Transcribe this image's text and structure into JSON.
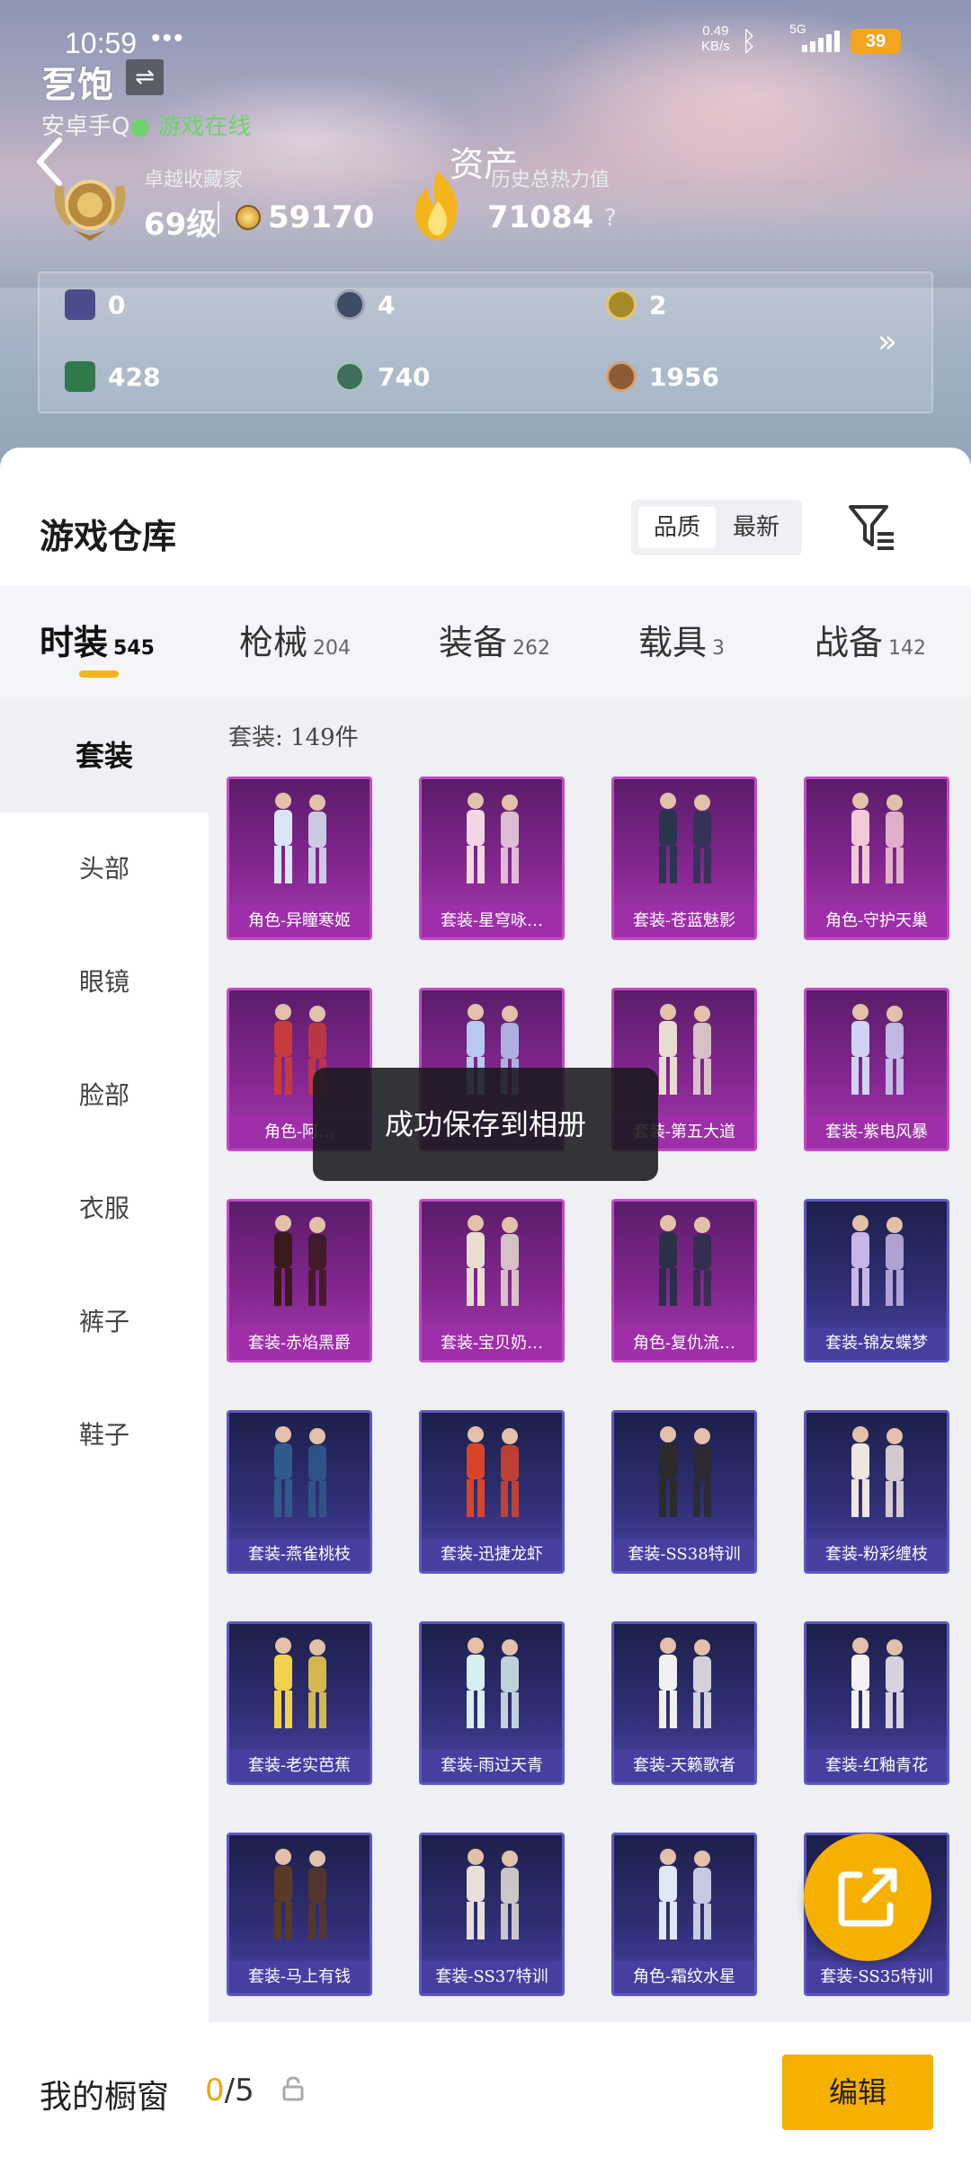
{
  "status_bar": {
    "time": "10:59",
    "dots": "•••",
    "net_speed": "0.49",
    "net_unit": "KB/s",
    "signal": "5G",
    "battery": "39"
  },
  "profile": {
    "name": "乭饱",
    "platform": "安卓手Q",
    "status": "游戏在线"
  },
  "page_title": "资产",
  "collection": {
    "title": "卓越收藏家",
    "level": "69级",
    "coins": "59170"
  },
  "heat": {
    "title": "历史总热力值",
    "value": "71084",
    "help": "?"
  },
  "stats": [
    {
      "icon": "book-icon",
      "value": "0",
      "color": "#4a4d8c"
    },
    {
      "icon": "round-badge-icon",
      "value": "4",
      "color": "#3d4b63"
    },
    {
      "icon": "gold-badge-icon",
      "value": "2",
      "color": "#a68a2a"
    },
    {
      "icon": "green-card-icon",
      "value": "428",
      "color": "#2f7a4c"
    },
    {
      "icon": "green-orb-icon",
      "value": "740",
      "color": "#3f6e5a"
    },
    {
      "icon": "bronze-badge-icon",
      "value": "1956",
      "color": "#8c5a35"
    }
  ],
  "stats_more": "»",
  "warehouse": {
    "title": "游戏仓库",
    "sort": [
      "品质",
      "最新"
    ]
  },
  "tabs": [
    {
      "label": "时装",
      "count": "545"
    },
    {
      "label": "枪械",
      "count": "204"
    },
    {
      "label": "装备",
      "count": "262"
    },
    {
      "label": "载具",
      "count": "3"
    },
    {
      "label": "战备",
      "count": "142"
    }
  ],
  "sidebar": [
    "套装",
    "头部",
    "眼镜",
    "脸部",
    "衣服",
    "裤子",
    "鞋子"
  ],
  "items_count": "套装: 149件",
  "items": [
    {
      "caption": "角色-异瞳寒姬",
      "tier": "purple"
    },
    {
      "caption": "套装-星穹咏…",
      "tier": "purple"
    },
    {
      "caption": "套装-苍蓝魅影",
      "tier": "purple"
    },
    {
      "caption": "角色-守护天巢",
      "tier": "purple"
    },
    {
      "caption": "角色-阿…",
      "tier": "purple"
    },
    {
      "caption": "",
      "tier": "purple"
    },
    {
      "caption": "套装-第五大道",
      "tier": "purple"
    },
    {
      "caption": "套装-紫电风暴",
      "tier": "purple"
    },
    {
      "caption": "套装-赤焰黑爵",
      "tier": "purple"
    },
    {
      "caption": "套装-宝贝奶…",
      "tier": "purple"
    },
    {
      "caption": "角色-复仇流…",
      "tier": "purple"
    },
    {
      "caption": "套装-锦友蝶梦",
      "tier": "blue"
    },
    {
      "caption": "套装-燕雀桃枝",
      "tier": "blue"
    },
    {
      "caption": "套装-迅捷龙虾",
      "tier": "blue"
    },
    {
      "caption": "套装-SS38特训",
      "tier": "blue"
    },
    {
      "caption": "套装-粉彩缠枝",
      "tier": "blue"
    },
    {
      "caption": "套装-老实芭蕉",
      "tier": "blue"
    },
    {
      "caption": "套装-雨过天青",
      "tier": "blue"
    },
    {
      "caption": "套装-天籁歌者",
      "tier": "blue"
    },
    {
      "caption": "套装-红釉青花",
      "tier": "blue"
    },
    {
      "caption": "套装-马上有钱",
      "tier": "blue"
    },
    {
      "caption": "套装-SS37特训",
      "tier": "blue"
    },
    {
      "caption": "角色-霜纹水星",
      "tier": "blue"
    },
    {
      "caption": "套装-SS35特训",
      "tier": "blue"
    }
  ],
  "toast": "成功保存到相册",
  "showcase": {
    "label": "我的橱窗",
    "current": "0",
    "total": "/5"
  },
  "edit_button": "编辑",
  "colors": {
    "accent": "#f5b000",
    "purple_tier": "#a83ab1",
    "blue_tier": "#4a44a6",
    "online": "#6ed36a"
  }
}
